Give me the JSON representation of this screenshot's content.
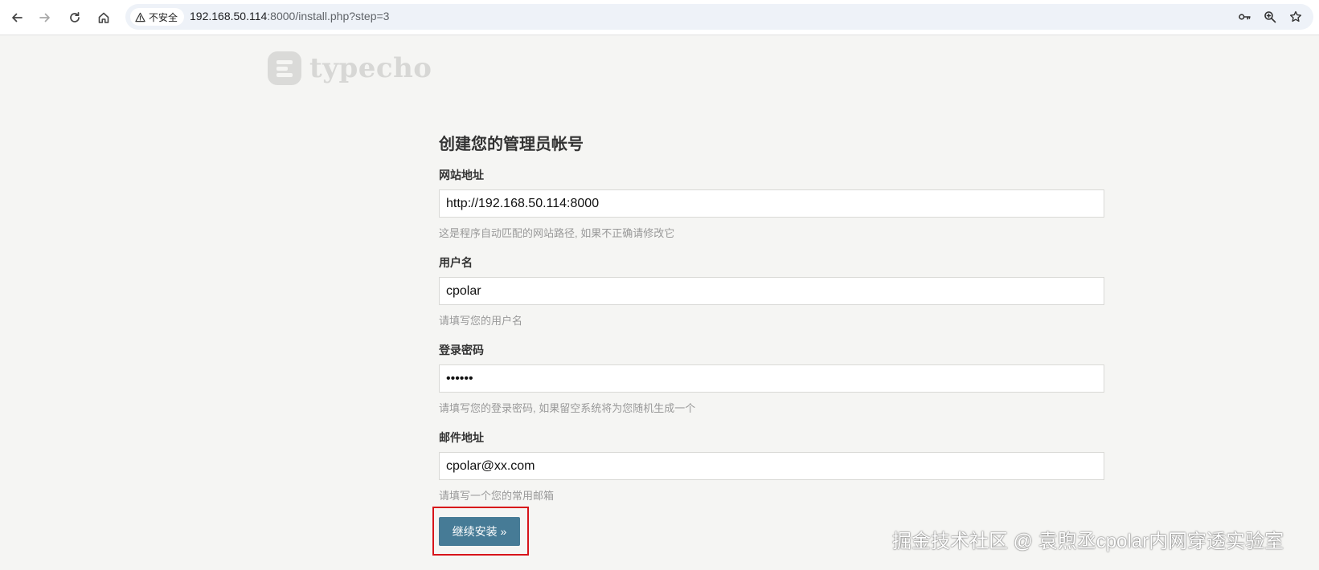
{
  "browser": {
    "security_label": "不安全",
    "url_host": "192.168.50.114",
    "url_path": ":8000/install.php?step=3"
  },
  "logo": {
    "text": "typecho"
  },
  "form": {
    "title": "创建您的管理员帐号",
    "site_url": {
      "label": "网站地址",
      "value": "http://192.168.50.114:8000",
      "desc": "这是程序自动匹配的网站路径, 如果不正确请修改它"
    },
    "username": {
      "label": "用户名",
      "value": "cpolar",
      "desc": "请填写您的用户名"
    },
    "password": {
      "label": "登录密码",
      "value": "cpolar",
      "desc": "请填写您的登录密码, 如果留空系统将为您随机生成一个"
    },
    "email": {
      "label": "邮件地址",
      "value": "cpolar@xx.com",
      "desc": "请填写一个您的常用邮箱"
    },
    "submit_label": "继续安装 »"
  },
  "watermark": "掘金技术社区 @ 袁煦丞cpolar内网穿透实验室",
  "colors": {
    "button": "#467b96",
    "highlight_box": "#d7141a",
    "page_background": "#f5f5f3"
  }
}
